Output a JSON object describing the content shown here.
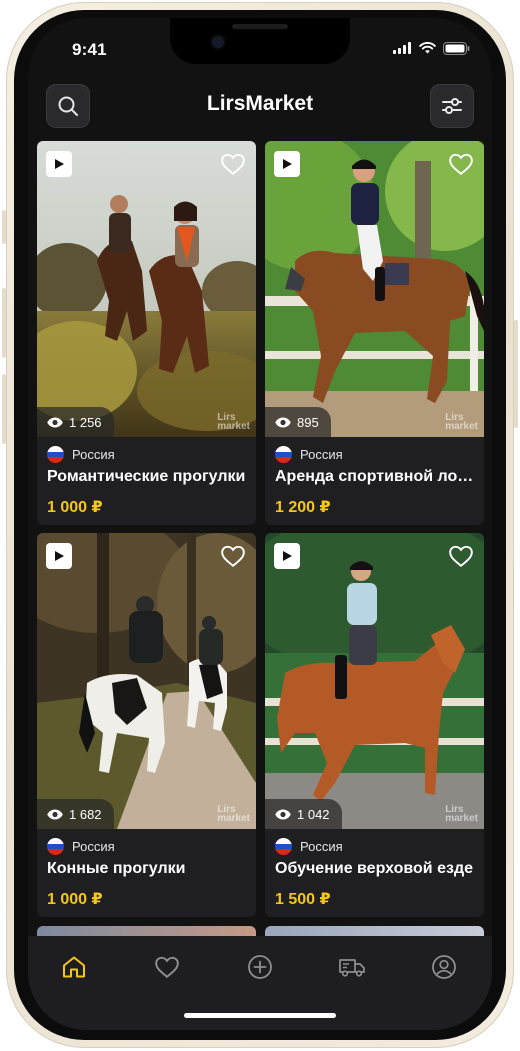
{
  "status": {
    "time": "9:41"
  },
  "header": {
    "title": "LirsMarket",
    "search_icon": "search-icon",
    "filter_icon": "sliders-icon"
  },
  "brand": {
    "line1": "Lirs",
    "line2": "market"
  },
  "listings": [
    {
      "views": "1 256",
      "country": "Россия",
      "title": "Романтические прогулки",
      "price": "1 000 ₽"
    },
    {
      "views": "895",
      "country": "Россия",
      "title": "Аренда спортивной лошади",
      "price": "1 200 ₽"
    },
    {
      "views": "1 682",
      "country": "Россия",
      "title": "Конные прогулки",
      "price": "1 000 ₽"
    },
    {
      "views": "1 042",
      "country": "Россия",
      "title": "Обучение верховой езде",
      "price": "1 500 ₽"
    }
  ],
  "tabs": [
    {
      "icon": "home-icon",
      "active": true
    },
    {
      "icon": "heart-icon",
      "active": false
    },
    {
      "icon": "plus-circle-icon",
      "active": false
    },
    {
      "icon": "truck-icon",
      "active": false
    },
    {
      "icon": "profile-icon",
      "active": false
    }
  ],
  "colors": {
    "accent": "#f5c518",
    "background": "#121212",
    "card": "#1f1f21",
    "tabbar": "#1e1e20"
  }
}
